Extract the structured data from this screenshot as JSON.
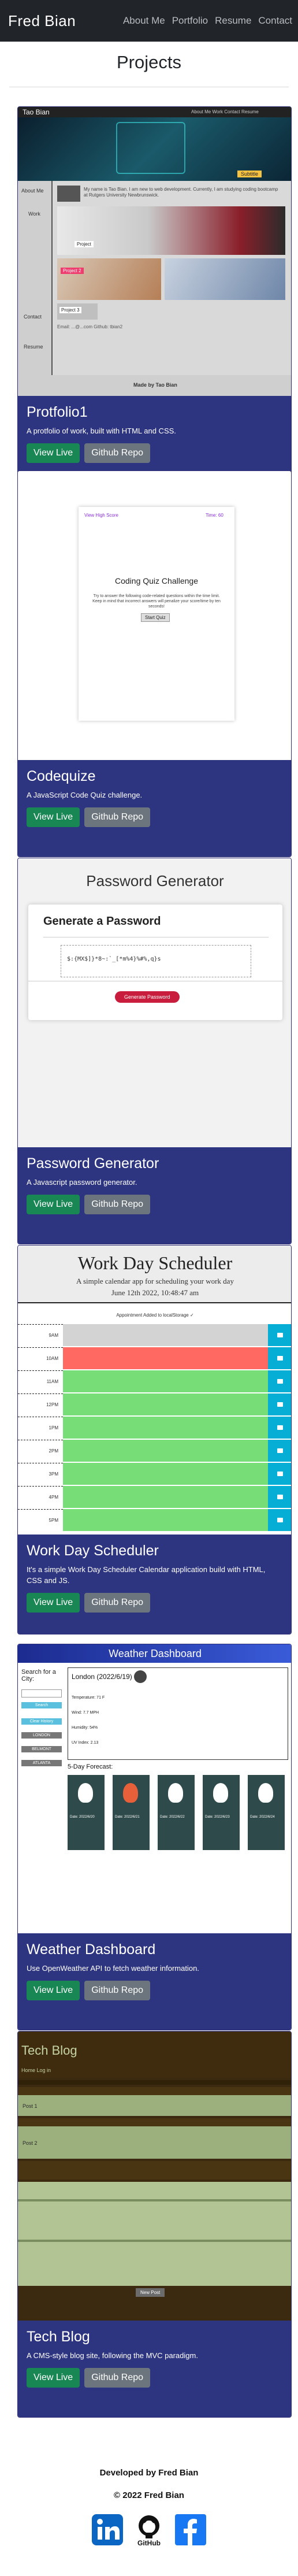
{
  "nav": {
    "brand": "Fred Bian",
    "links": [
      "About Me",
      "Portfolio",
      "Resume",
      "Contact"
    ]
  },
  "section": {
    "title": "Projects"
  },
  "buttons": {
    "live": "View Live",
    "repo": "Github Repo"
  },
  "projects": [
    {
      "title": "Protfolio1",
      "text": "A protfolio of work, built with HTML and CSS."
    },
    {
      "title": "Codequize",
      "text": "A JavaScript Code Quiz challenge."
    },
    {
      "title": "Password Generator",
      "text": "A Javascript password generator."
    },
    {
      "title": "Work Day Scheduler",
      "text": "It's a simple Work Day Scheduler Calendar application build with HTML, CSS and JS."
    },
    {
      "title": "Weather Dashboard",
      "text": "Use OpenWeather API to fetch weather information."
    },
    {
      "title": "Tech Blog",
      "text": "A CMS-style blog site, following the MVC paradigm."
    }
  ],
  "previews": {
    "portfolio": {
      "brand": "Tao Bian",
      "nav": "About Me   Work   Contact   Resume",
      "badge": "Subtitle",
      "side": [
        "About Me",
        "Work",
        "Contact",
        "Resume"
      ],
      "about": "My name is Tao Bian. I am new to web development. Currently, I am studying coding bootcamp at Rutgers University Newbrunswick.",
      "label_project": "Project",
      "label_project2": "Project 2",
      "label_project3": "Project 3",
      "contact": "Email: ...@...com  Github: tbian2",
      "footer": "Made by Tao Bian"
    },
    "quiz": {
      "link": "View High Score",
      "timer": "Time: 60",
      "title": "Coding Quiz Challenge",
      "desc": "Try to answer the following code-related questions within the time limit. Keep in mind that incorrect answers will penalize your score/time by ten seconds!",
      "start": "Start Quiz"
    },
    "password": {
      "header": "Password Generator",
      "card_title": "Generate a Password",
      "sample": "$:{MX$]}*8~:`_[*m%4}%#%,q}s",
      "button": "Generate Password"
    },
    "scheduler": {
      "title": "Work Day Scheduler",
      "subtitle": "A simple calendar app for scheduling your work day",
      "date": "June 12th 2022, 10:48:47 am",
      "notice": "Appointment Added to localStorage ✓",
      "hours": [
        "9AM",
        "10AM",
        "11AM",
        "12PM",
        "1PM",
        "2PM",
        "3PM",
        "4PM",
        "5PM"
      ]
    },
    "weather": {
      "title": "Weather Dashboard",
      "search": "Search for a City:",
      "search_btn": "Search",
      "cities": [
        "Clear History",
        "LONDON",
        "BELMONT",
        "ATLANTA"
      ],
      "city": "London (2022/6/19)",
      "stats": [
        "Temperature: 71 F",
        "Wind: 7.7 MPH",
        "Humidity: 54%",
        "UV Index: 2.13"
      ],
      "forecast": "5-Day Forecast:",
      "days": [
        "Date: 2022/6/20",
        "Date: 2022/6/21",
        "Date: 2022/6/22",
        "Date: 2022/6/23",
        "Date: 2022/6/24"
      ]
    },
    "blog": {
      "title": "Tech Blog",
      "nav": "Home  Log in",
      "posts": [
        "Post 1",
        "Post 2"
      ],
      "button": "New Post"
    }
  },
  "footer": {
    "developed": "Developed by Fred Bian",
    "copyright": "© 2022 Fred Bian"
  },
  "icons": [
    "linkedin-icon",
    "github-icon",
    "facebook-icon"
  ],
  "colors": {
    "navbar": "#212529",
    "card_body": "#2e3580",
    "btn_live": "#198754",
    "btn_repo": "#6c757d",
    "linkedin": "#0a66c2",
    "facebook": "#1877f2"
  }
}
